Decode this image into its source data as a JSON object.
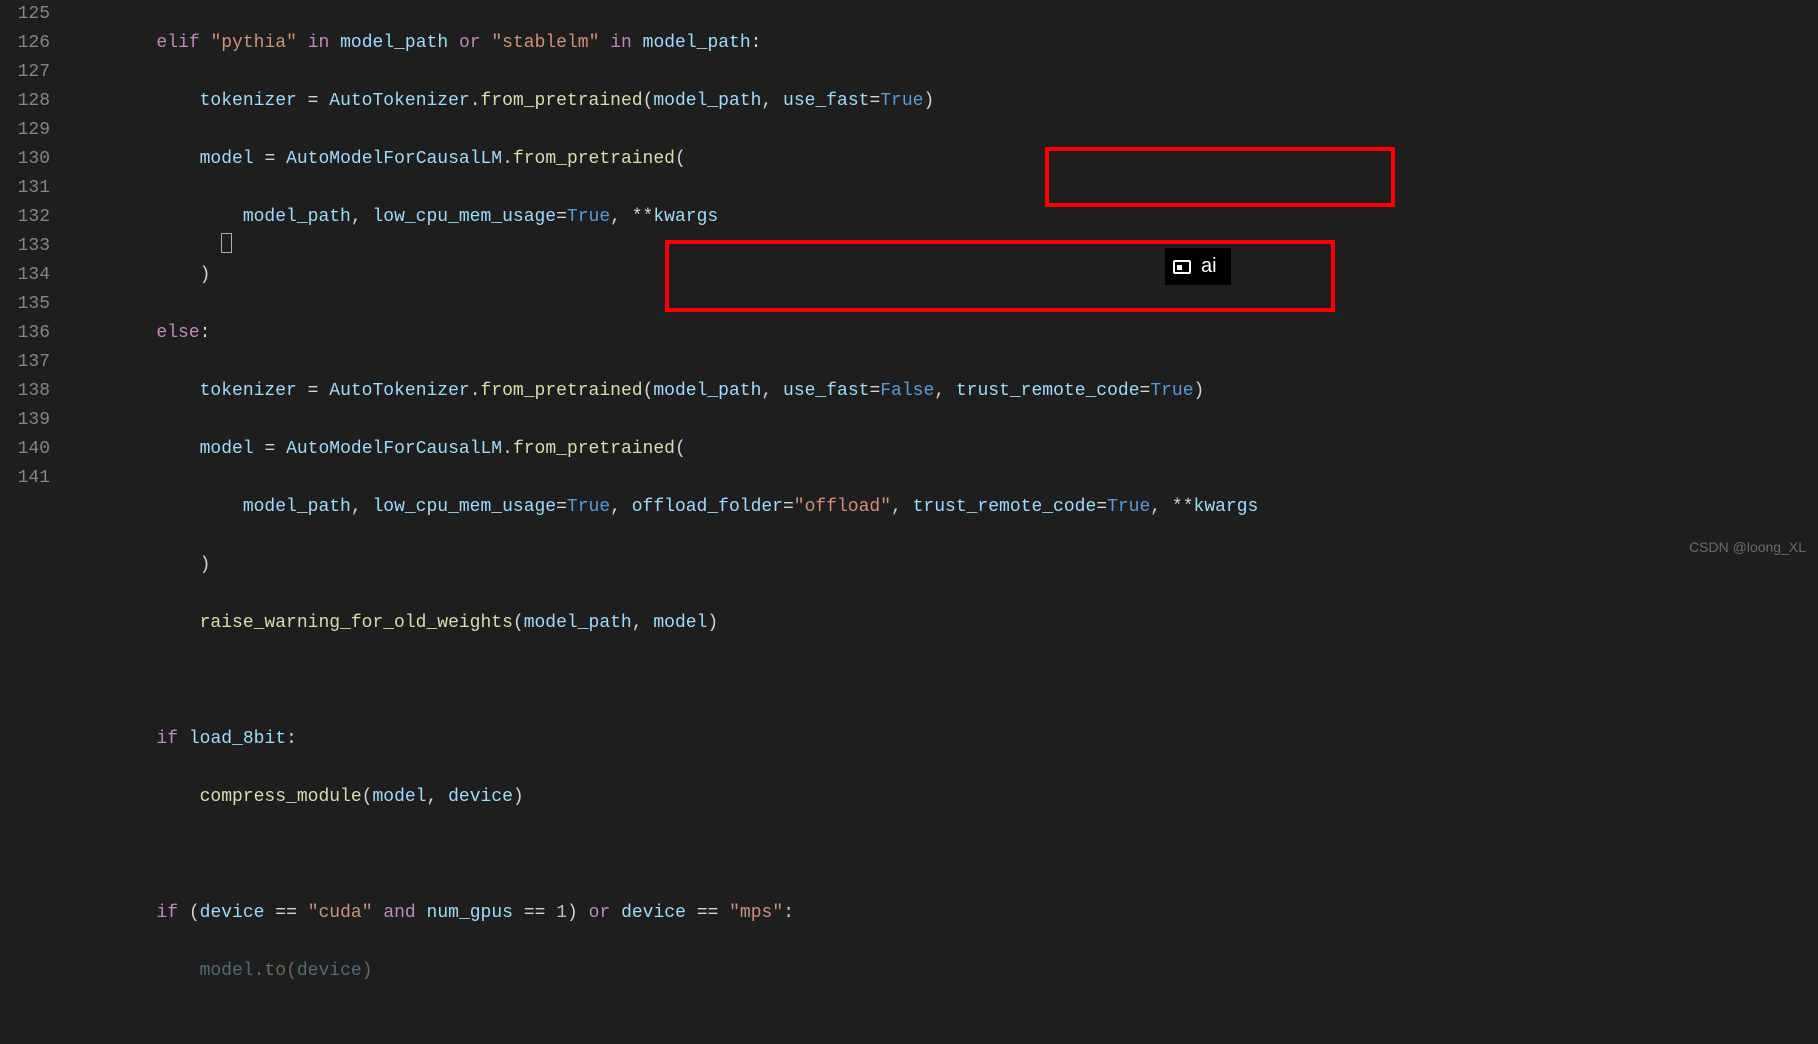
{
  "gutter": {
    "start": 125,
    "end": 141
  },
  "code": {
    "l125": {
      "indent": "        ",
      "kw1": "elif",
      "sp1": " ",
      "str1": "\"pythia\"",
      "sp2": " ",
      "kw2": "in",
      "sp3": " ",
      "var1": "model_path",
      "sp4": " ",
      "kw3": "or",
      "sp5": " ",
      "str2": "\"stablelm\"",
      "sp6": " ",
      "kw4": "in",
      "sp7": " ",
      "var2": "model_path",
      "punct": ":"
    },
    "l126": {
      "indent": "            ",
      "var1": "tokenizer",
      "sp1": " ",
      "op1": "=",
      "sp2": " ",
      "cls": "AutoTokenizer",
      "dot": ".",
      "meth": "from_pretrained",
      "p1": "(",
      "arg1": "model_path",
      "c1": ", ",
      "kw1": "use_fast",
      "eq": "=",
      "val": "True",
      "p2": ")"
    },
    "l127": {
      "indent": "            ",
      "var1": "model",
      "sp1": " ",
      "op1": "=",
      "sp2": " ",
      "cls": "AutoModelForCausalLM",
      "dot": ".",
      "meth": "from_pretrained",
      "p1": "("
    },
    "l128": {
      "indent": "                ",
      "arg1": "model_path",
      "c1": ", ",
      "kw1": "low_cpu_mem_usage",
      "eq": "=",
      "val": "True",
      "c2": ", ",
      "star": "**",
      "kwargs": "kwargs"
    },
    "l129": {
      "indent": "            ",
      "p1": ")"
    },
    "l130": {
      "indent": "        ",
      "kw1": "else",
      "punct": ":"
    },
    "l131": {
      "indent": "            ",
      "var1": "tokenizer",
      "sp1": " ",
      "op1": "=",
      "sp2": " ",
      "cls": "AutoTokenizer",
      "dot": ".",
      "meth": "from_pretrained",
      "p1": "(",
      "arg1": "model_path",
      "c1": ", ",
      "kw1": "use_fast",
      "eq1": "=",
      "val1": "False",
      "c2": ", ",
      "kw2": "trust_remote_code",
      "eq2": "=",
      "val2": "True",
      "p2": ")"
    },
    "l132": {
      "indent": "            ",
      "var1": "model",
      "sp1": " ",
      "op1": "=",
      "sp2": " ",
      "cls": "AutoModelForCausalLM",
      "dot": ".",
      "meth": "from_pretrained",
      "p1": "("
    },
    "l133": {
      "indent": "                ",
      "arg1": "model_path",
      "c1": ", ",
      "kw1": "low_cpu_mem_usage",
      "eq1": "=",
      "val1": "True",
      "c2": ", ",
      "kw2": "offload_folder",
      "eq2": "=",
      "val2": "\"offload\"",
      "c3": ", ",
      "kw3": "trust_remote_code",
      "eq3": "=",
      "val3": "True",
      "c4": ", ",
      "star": "**",
      "kwargs": "kwargs"
    },
    "l134": {
      "indent": "            ",
      "p1": ")"
    },
    "l135": {
      "indent": "            ",
      "fn": "raise_warning_for_old_weights",
      "p1": "(",
      "arg1": "model_path",
      "c1": ", ",
      "arg2": "model",
      "p2": ")"
    },
    "l136": {
      "indent": ""
    },
    "l137": {
      "indent": "        ",
      "kw1": "if",
      "sp1": " ",
      "var1": "load_8bit",
      "punct": ":"
    },
    "l138": {
      "indent": "            ",
      "fn": "compress_module",
      "p1": "(",
      "arg1": "model",
      "c1": ", ",
      "arg2": "device",
      "p2": ")"
    },
    "l139": {
      "indent": ""
    },
    "l140": {
      "indent": "        ",
      "kw1": "if",
      "sp1": " ",
      "p1": "(",
      "var1": "device",
      "sp2": " ",
      "op1": "==",
      "sp3": " ",
      "str1": "\"cuda\"",
      "sp4": " ",
      "kw2": "and",
      "sp5": " ",
      "var2": "num_gpus",
      "sp6": " ",
      "op2": "==",
      "sp7": " ",
      "num": "1",
      "p2": ")",
      "sp8": " ",
      "kw3": "or",
      "sp9": " ",
      "var3": "device",
      "sp10": " ",
      "op3": "==",
      "sp11": " ",
      "str2": "\"mps\"",
      "punct": ":"
    },
    "l141": {
      "indent": "            ",
      "var1": "model",
      "dot": ".",
      "meth": "to",
      "p1": "(",
      "arg1": "device",
      "p2": ")"
    }
  },
  "ime": {
    "text": "ai"
  },
  "watermark": "CSDN @loong_XL"
}
